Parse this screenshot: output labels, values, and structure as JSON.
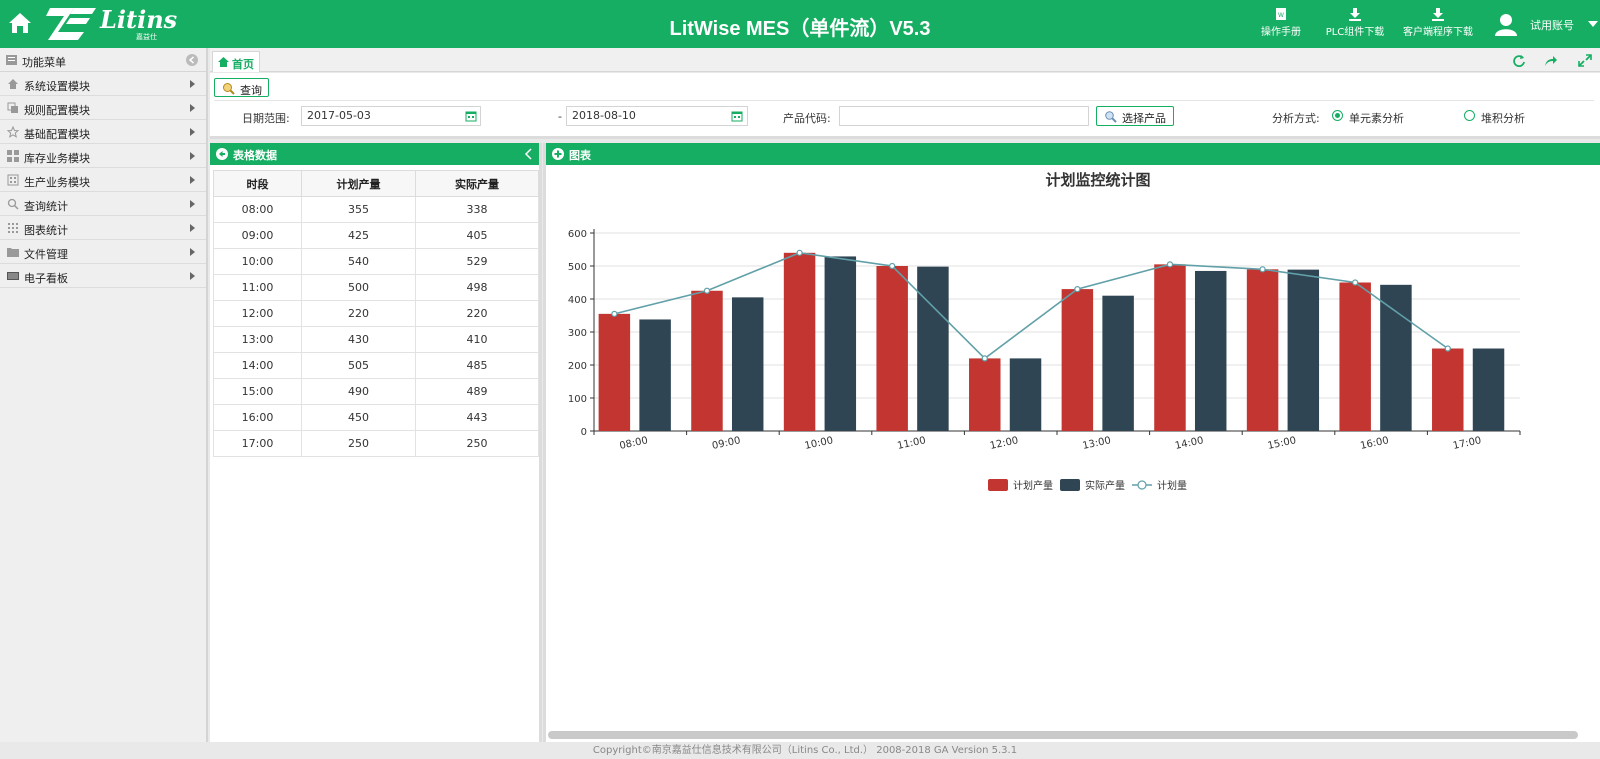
{
  "header": {
    "logo_text": "Litins",
    "logo_sub": "嘉益仕",
    "title": "LitWise MES（单件流）V5.3",
    "tools": [
      {
        "label": "操作手册",
        "icon": "manual-icon"
      },
      {
        "label": "PLC组件下载",
        "icon": "download-icon"
      },
      {
        "label": "客户端程序下载",
        "icon": "download-icon"
      }
    ],
    "user": "试用账号"
  },
  "sidebar": {
    "title": "功能菜单",
    "items": [
      {
        "label": "系统设置模块",
        "icon": "home-icon"
      },
      {
        "label": "规则配置模块",
        "icon": "rules-icon"
      },
      {
        "label": "基础配置模块",
        "icon": "star-icon"
      },
      {
        "label": "库存业务模块",
        "icon": "grid-icon"
      },
      {
        "label": "生产业务模块",
        "icon": "grid-icon"
      },
      {
        "label": "查询统计",
        "icon": "search-icon"
      },
      {
        "label": "图表统计",
        "icon": "chart-icon"
      },
      {
        "label": "文件管理",
        "icon": "folder-icon"
      },
      {
        "label": "电子看板",
        "icon": "board-icon"
      }
    ]
  },
  "tabs": [
    {
      "label": "首页",
      "active": true
    }
  ],
  "query": {
    "button": "查询",
    "date_label": "日期范围:",
    "date_from": "2017-05-03",
    "date_sep": "-",
    "date_to": "2018-08-10",
    "product_label": "产品代码:",
    "product_value": "",
    "select_product": "选择产品",
    "mode_label": "分析方式:",
    "modes": [
      {
        "label": "单元素分析",
        "selected": true
      },
      {
        "label": "堆积分析",
        "selected": false
      }
    ]
  },
  "table_panel": {
    "title": "表格数据",
    "columns": [
      "时段",
      "计划产量",
      "实际产量"
    ],
    "rows": [
      [
        "08:00",
        "355",
        "338"
      ],
      [
        "09:00",
        "425",
        "405"
      ],
      [
        "10:00",
        "540",
        "529"
      ],
      [
        "11:00",
        "500",
        "498"
      ],
      [
        "12:00",
        "220",
        "220"
      ],
      [
        "13:00",
        "430",
        "410"
      ],
      [
        "14:00",
        "505",
        "485"
      ],
      [
        "15:00",
        "490",
        "489"
      ],
      [
        "16:00",
        "450",
        "443"
      ],
      [
        "17:00",
        "250",
        "250"
      ]
    ]
  },
  "chart_panel": {
    "title": "图表"
  },
  "chart_data": {
    "type": "bar",
    "title": "计划监控统计图",
    "categories": [
      "08:00",
      "09:00",
      "10:00",
      "11:00",
      "12:00",
      "13:00",
      "14:00",
      "15:00",
      "16:00",
      "17:00"
    ],
    "series": [
      {
        "name": "计划产量",
        "type": "bar",
        "color": "#c23531",
        "values": [
          355,
          425,
          540,
          500,
          220,
          430,
          505,
          490,
          450,
          250
        ]
      },
      {
        "name": "实际产量",
        "type": "bar",
        "color": "#2f4554",
        "values": [
          338,
          405,
          529,
          498,
          220,
          410,
          485,
          489,
          443,
          250
        ]
      },
      {
        "name": "计划量",
        "type": "line",
        "color": "#61a0a8",
        "values": [
          355,
          425,
          540,
          500,
          220,
          430,
          505,
          490,
          450,
          250
        ]
      }
    ],
    "ylim": [
      0,
      600
    ],
    "yticks": [
      0,
      100,
      200,
      300,
      400,
      500,
      600
    ],
    "grid": true,
    "legend": "bottom"
  },
  "footer": "Copyright©南京嘉益仕信息技术有限公司（Litins Co., Ltd.） 2008-2018 GA Version 5.3.1",
  "colors": {
    "brand": "#16ae63"
  }
}
